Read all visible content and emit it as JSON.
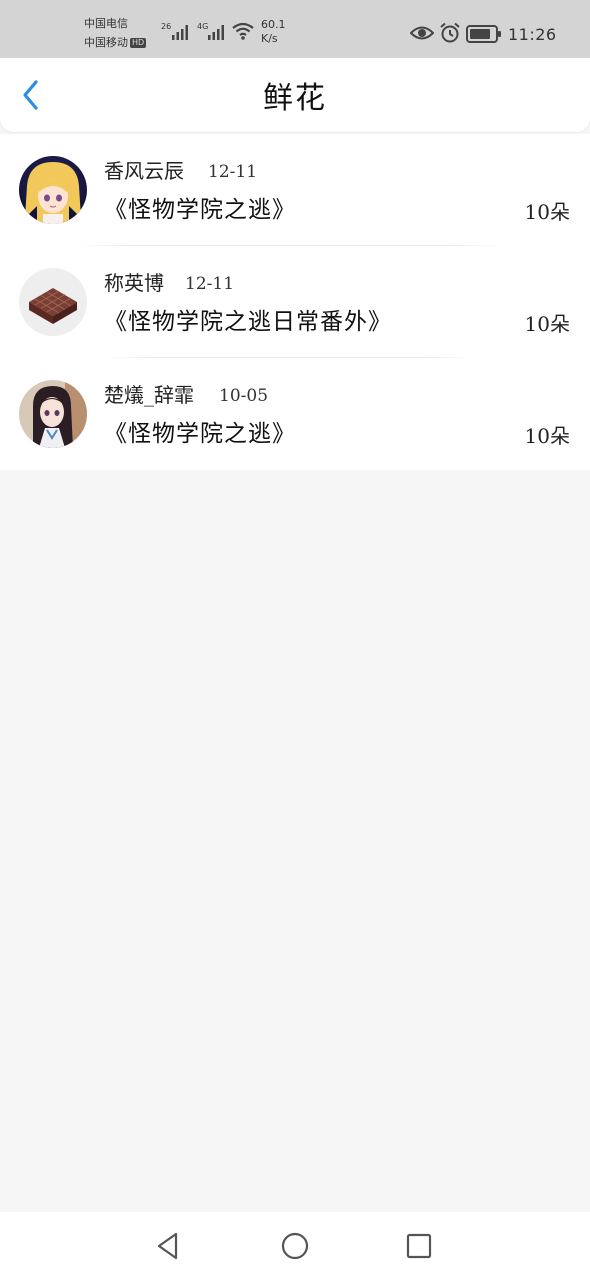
{
  "status_bar": {
    "carrier_1": "中国电信",
    "carrier_2": "中国移动",
    "hd_badge": "HD",
    "net_1": "26",
    "net_2": "4G",
    "speed_value": "60.1",
    "speed_unit": "K/s",
    "time": "11:26"
  },
  "header": {
    "title": "鲜花",
    "back_icon": "chevron-left-icon",
    "accent_color": "#2b8fe0"
  },
  "list": [
    {
      "user": "香风云辰",
      "date": "12-11",
      "book": "《怪物学院之逃》",
      "count": "10朵"
    },
    {
      "user": "称英博",
      "date": "12-11",
      "book": "《怪物学院之逃日常番外》",
      "count": "10朵"
    },
    {
      "user": "楚燨_辞霏",
      "date": "10-05",
      "book": "《怪物学院之逃》",
      "count": "10朵"
    }
  ],
  "nav_bar": {
    "back_icon": "triangle-back-icon",
    "home_icon": "circle-home-icon",
    "recent_icon": "square-recent-icon"
  }
}
